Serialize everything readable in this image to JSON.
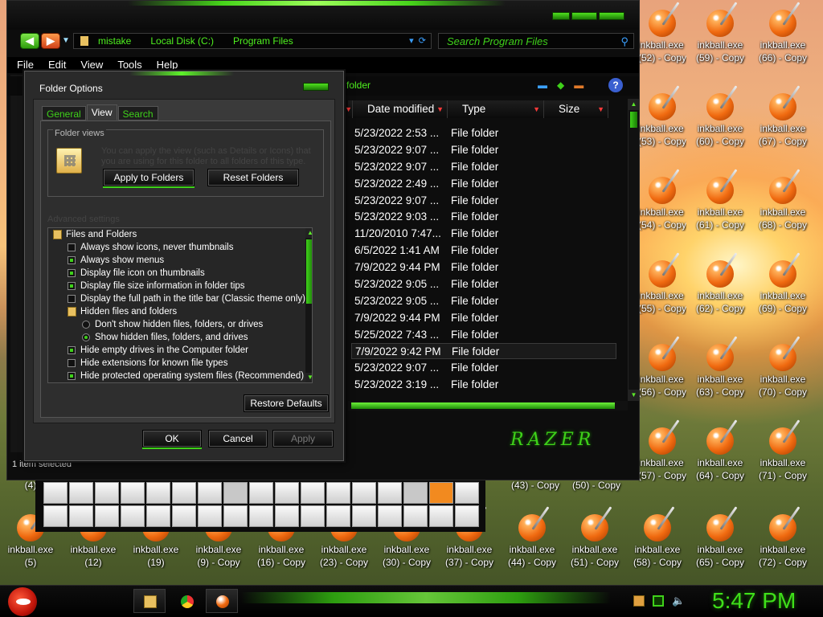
{
  "explorer": {
    "breadcrumb": [
      "mistake",
      "Local Disk (C:)",
      "Program Files"
    ],
    "search_placeholder": "Search Program Files",
    "menu": [
      "File",
      "Edit",
      "View",
      "Tools",
      "Help"
    ],
    "folder_crumb": "folder",
    "columns": [
      "Date modified",
      "Type",
      "Size"
    ],
    "rows": [
      {
        "date": "5/23/2022 2:53 ...",
        "type": "File folder"
      },
      {
        "date": "5/23/2022 9:07 ...",
        "type": "File folder"
      },
      {
        "date": "5/23/2022 9:07 ...",
        "type": "File folder"
      },
      {
        "date": "5/23/2022 2:49 ...",
        "type": "File folder"
      },
      {
        "date": "5/23/2022 9:07 ...",
        "type": "File folder"
      },
      {
        "date": "5/23/2022 9:03 ...",
        "type": "File folder"
      },
      {
        "date": "11/20/2010 7:47...",
        "type": "File folder"
      },
      {
        "date": "6/5/2022 1:41 AM",
        "type": "File folder"
      },
      {
        "date": "7/9/2022 9:44 PM",
        "type": "File folder"
      },
      {
        "date": "5/23/2022 9:05 ...",
        "type": "File folder"
      },
      {
        "date": "5/23/2022 9:05 ...",
        "type": "File folder"
      },
      {
        "date": "7/9/2022 9:44 PM",
        "type": "File folder"
      },
      {
        "date": "5/25/2022 7:43 ...",
        "type": "File folder"
      },
      {
        "date": "7/9/2022 9:42 PM",
        "type": "File folder"
      },
      {
        "date": "5/23/2022 9:07 ...",
        "type": "File folder"
      },
      {
        "date": "5/23/2022 3:19 ...",
        "type": "File folder"
      }
    ],
    "brand": "RAZER",
    "status": "1 item selected"
  },
  "dialog": {
    "title": "Folder Options",
    "tabs": [
      "General",
      "View",
      "Search"
    ],
    "folder_views_label": "Folder views",
    "folder_views_text": "You can apply the view (such as Details or Icons) that you are using for this folder to all folders of this type.",
    "apply_to_folders": "Apply to Folders",
    "reset_folders": "Reset Folders",
    "advanced_label": "Advanced settings",
    "tree": [
      {
        "kind": "folder",
        "label": "Files and Folders"
      },
      {
        "kind": "check",
        "checked": false,
        "label": "Always show icons, never thumbnails"
      },
      {
        "kind": "check",
        "checked": true,
        "label": "Always show menus"
      },
      {
        "kind": "check",
        "checked": true,
        "label": "Display file icon on thumbnails"
      },
      {
        "kind": "check",
        "checked": true,
        "label": "Display file size information in folder tips"
      },
      {
        "kind": "check",
        "checked": false,
        "label": "Display the full path in the title bar (Classic theme only)"
      },
      {
        "kind": "folder2",
        "label": "Hidden files and folders"
      },
      {
        "kind": "radio",
        "checked": false,
        "label": "Don't show hidden files, folders, or drives"
      },
      {
        "kind": "radio",
        "checked": true,
        "label": "Show hidden files, folders, and drives"
      },
      {
        "kind": "check",
        "checked": true,
        "label": "Hide empty drives in the Computer folder"
      },
      {
        "kind": "check",
        "checked": false,
        "label": "Hide extensions for known file types"
      },
      {
        "kind": "check",
        "checked": true,
        "label": "Hide protected operating system files (Recommended)"
      }
    ],
    "restore_defaults": "Restore Defaults",
    "ok": "OK",
    "cancel": "Cancel",
    "apply": "Apply"
  },
  "desktop": {
    "icons": [
      {
        "l1": "inkball.exe",
        "l2": "(52) - Copy"
      },
      {
        "l1": "inkball.exe",
        "l2": "(59) - Copy"
      },
      {
        "l1": "inkball.exe",
        "l2": "(66) - Copy"
      },
      {
        "l1": "inkball.exe",
        "l2": "(53) - Copy"
      },
      {
        "l1": "inkball.exe",
        "l2": "(60) - Copy"
      },
      {
        "l1": "inkball.exe",
        "l2": "(67) - Copy"
      },
      {
        "l1": "inkball.exe",
        "l2": "(54) - Copy"
      },
      {
        "l1": "inkball.exe",
        "l2": "(61) - Copy"
      },
      {
        "l1": "inkball.exe",
        "l2": "(68) - Copy"
      },
      {
        "l1": "inkball.exe",
        "l2": "(55) - Copy"
      },
      {
        "l1": "inkball.exe",
        "l2": "(62) - Copy"
      },
      {
        "l1": "inkball.exe",
        "l2": "(69) - Copy"
      },
      {
        "l1": "inkball.exe",
        "l2": "(56) - Copy"
      },
      {
        "l1": "inkball.exe",
        "l2": "(63) - Copy"
      },
      {
        "l1": "inkball.exe",
        "l2": "(70) - Copy"
      },
      {
        "l1": "inkball.exe",
        "l2": "(57) - Copy"
      },
      {
        "l1": "inkball.exe",
        "l2": "(64) - Copy"
      },
      {
        "l1": "inkball.exe",
        "l2": "(71) - Copy"
      }
    ],
    "mid_labels": [
      "(4)",
      "(43) - Copy",
      "(50) - Copy"
    ],
    "bottom_icons": [
      {
        "l1": "inkball.exe",
        "l2": "(5)"
      },
      {
        "l1": "inkball.exe",
        "l2": "(12)"
      },
      {
        "l1": "inkball.exe",
        "l2": "(19)"
      },
      {
        "l1": "inkball.exe",
        "l2": "(9) - Copy"
      },
      {
        "l1": "inkball.exe",
        "l2": "(16) - Copy"
      },
      {
        "l1": "inkball.exe",
        "l2": "(23) - Copy"
      },
      {
        "l1": "inkball.exe",
        "l2": "(30) - Copy"
      },
      {
        "l1": "inkball.exe",
        "l2": "(37) - Copy"
      },
      {
        "l1": "inkball.exe",
        "l2": "(44) - Copy"
      },
      {
        "l1": "inkball.exe",
        "l2": "(51) - Copy"
      },
      {
        "l1": "inkball.exe",
        "l2": "(58) - Copy"
      },
      {
        "l1": "inkball.exe",
        "l2": "(65) - Copy"
      },
      {
        "l1": "inkball.exe",
        "l2": "(72) - Copy"
      }
    ]
  },
  "taskbar": {
    "clock": "5:47 PM",
    "pinned": [
      "explorer-icon",
      "chrome-icon",
      "inkball-icon"
    ],
    "tray": [
      "flag-icon",
      "battery-icon",
      "volume-icon"
    ]
  },
  "colors": {
    "accent": "#3fd11a",
    "dark": "#0d0d0d"
  }
}
